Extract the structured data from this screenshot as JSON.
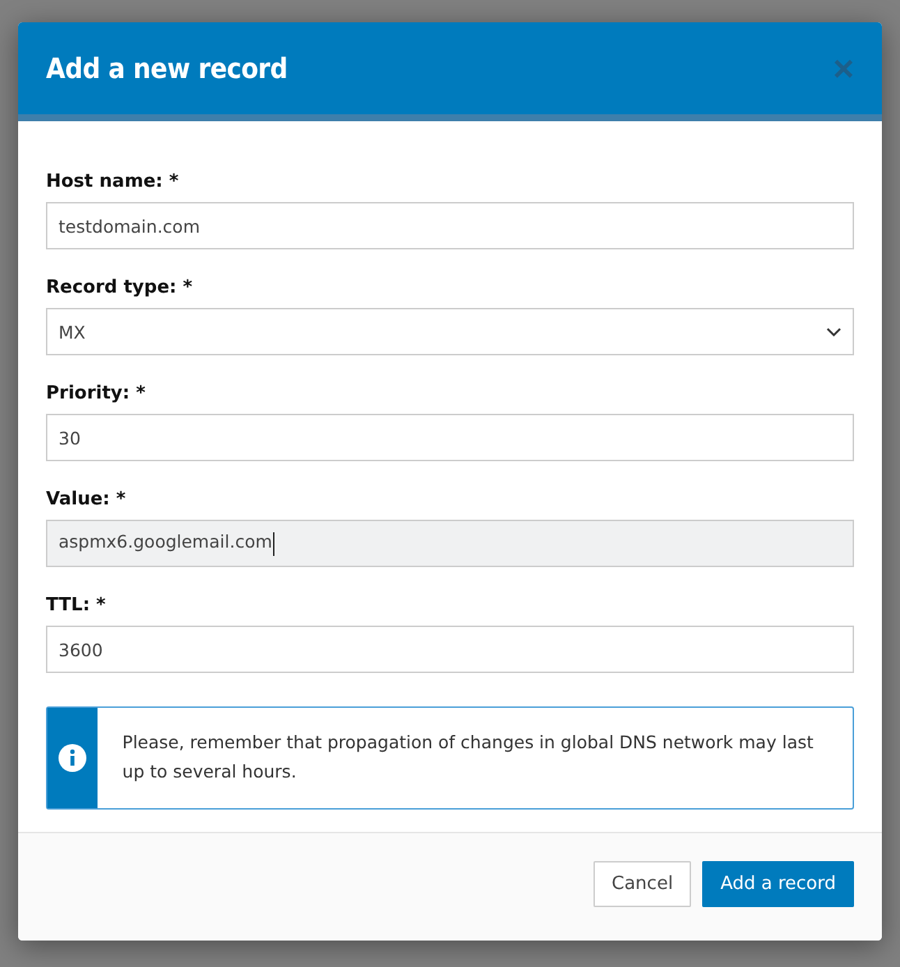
{
  "dialog": {
    "title": "Add a new record",
    "close": "×"
  },
  "fields": [
    {
      "kind": "text",
      "label": "Host name: *",
      "value": "testdomain.com",
      "focused": false
    },
    {
      "kind": "select",
      "label": "Record type: *",
      "value": "MX",
      "focused": false
    },
    {
      "kind": "text",
      "label": "Priority: *",
      "value": "30",
      "focused": false
    },
    {
      "kind": "text",
      "label": "Value: *",
      "value": "aspmx6.googlemail.com",
      "focused": true
    },
    {
      "kind": "text",
      "label": "TTL: *",
      "value": "3600",
      "focused": false
    }
  ],
  "notice": "Please, remember that propagation of changes in global DNS network may last up to several hours.",
  "buttons": [
    {
      "label": "Cancel",
      "kind": "secondary"
    },
    {
      "label": "Add a record",
      "kind": "primary"
    }
  ]
}
